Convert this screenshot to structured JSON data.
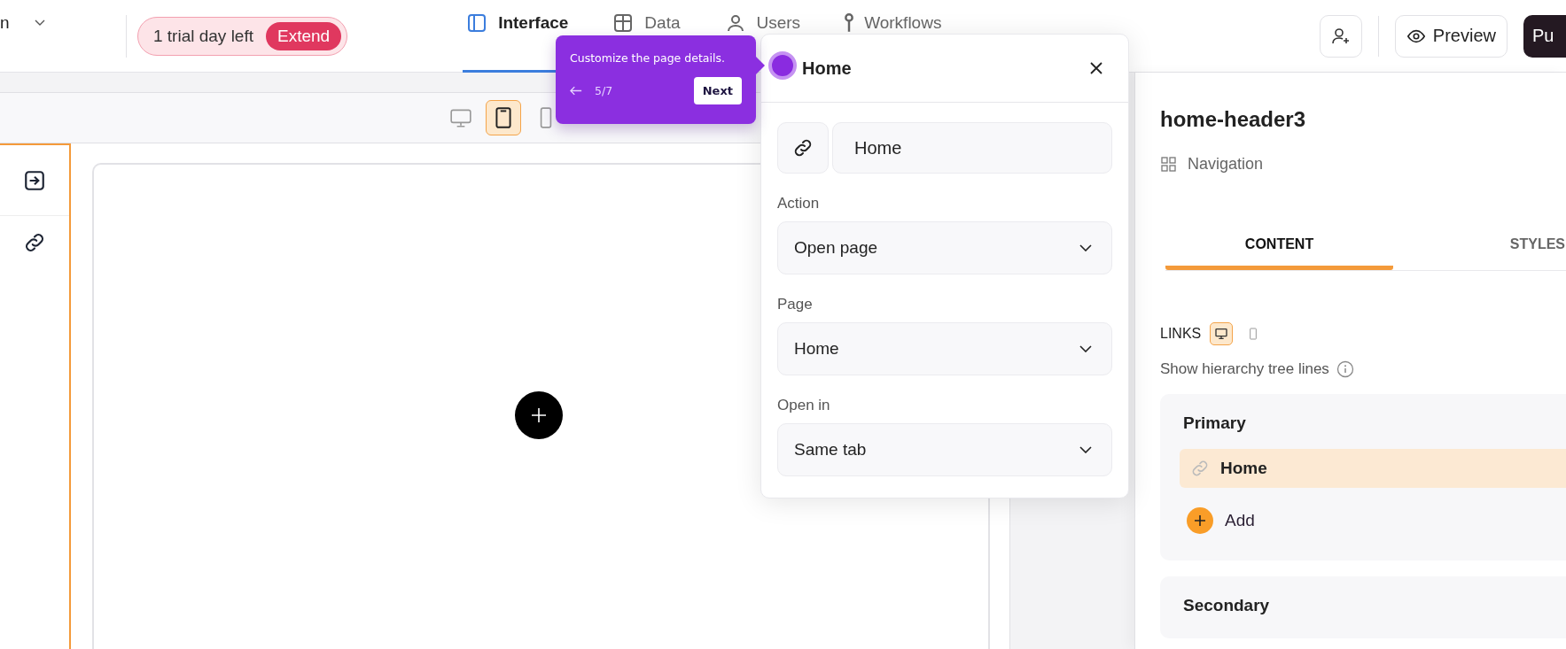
{
  "header": {
    "project_menu": "n",
    "trial": {
      "text": "1 trial day left",
      "action": "Extend"
    },
    "tabs": [
      {
        "kind": "interface",
        "label": "Interface",
        "selected": true
      },
      {
        "kind": "data",
        "label": "Data",
        "selected": false
      },
      {
        "kind": "users",
        "label": "Users",
        "selected": false
      },
      {
        "kind": "workflows",
        "label": "Workflows",
        "selected": false
      }
    ],
    "preview": "Preview",
    "publish": "Pu"
  },
  "canvas": {
    "devices": [
      {
        "kind": "desktop",
        "selected": false
      },
      {
        "kind": "tablet",
        "selected": true
      },
      {
        "kind": "mobile",
        "selected": false
      }
    ],
    "side_tools": [
      {
        "kind": "enter"
      },
      {
        "kind": "link"
      }
    ]
  },
  "tour": {
    "text": "Customize the page details.",
    "step": "5/7",
    "next": "Next"
  },
  "link_popup": {
    "title": "Home",
    "name": "Home",
    "fields": [
      {
        "label": "Action",
        "value": "Open page"
      },
      {
        "label": "Page",
        "value": "Home"
      },
      {
        "label": "Open in",
        "value": "Same tab"
      }
    ]
  },
  "inspector": {
    "title": "home-header3",
    "type": "Navigation",
    "tabs": [
      {
        "label": "CONTENT",
        "selected": true
      },
      {
        "label": "STYLES",
        "selected": false
      }
    ],
    "links_label": "LINKS",
    "link_devices": [
      {
        "kind": "desktop",
        "selected": true
      },
      {
        "kind": "mobile",
        "selected": false
      }
    ],
    "tree_lines_label": "Show hierarchy tree lines",
    "groups": [
      {
        "title": "Primary",
        "items": [
          {
            "label": "Home",
            "selected": true
          }
        ],
        "add": "Add"
      },
      {
        "title": "Secondary"
      }
    ]
  }
}
